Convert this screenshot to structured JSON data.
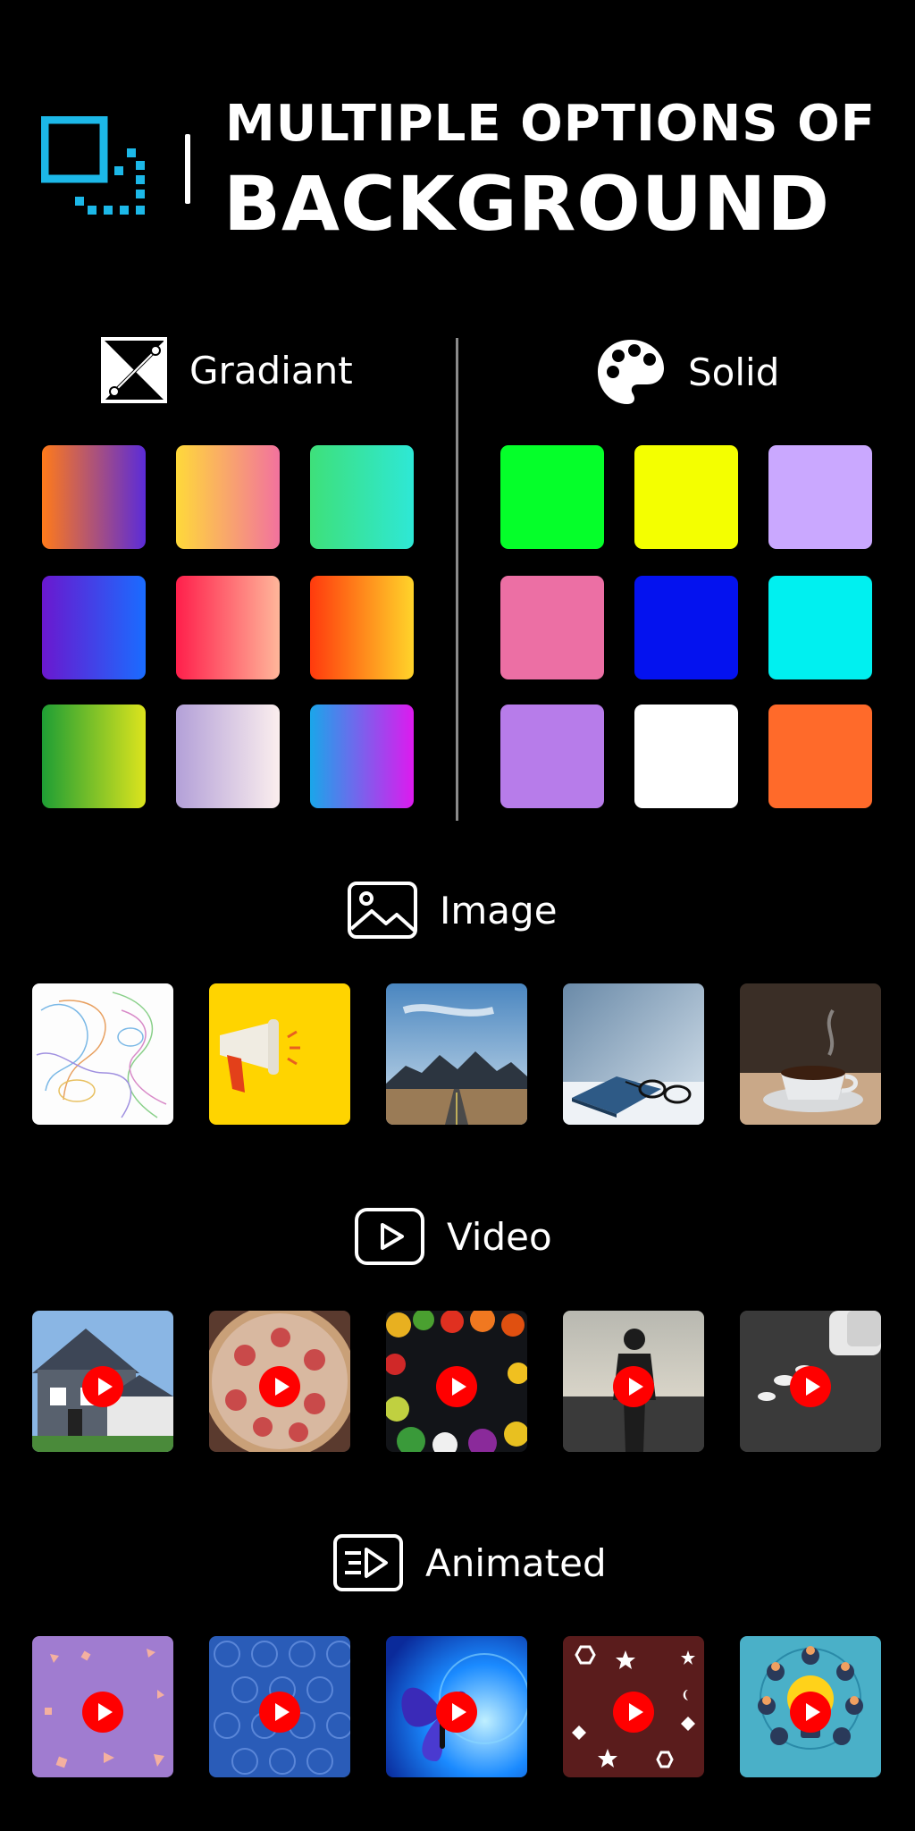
{
  "header": {
    "title_line1": "MULTIPLE OPTIONS OF",
    "title_line2": "BACKGROUND",
    "icon": "resize-frame-icon",
    "accent": "#1cb8e8"
  },
  "gradient": {
    "label": "Gradiant",
    "icon": "gradient-frame-icon",
    "swatches": [
      [
        "#ff7a1a",
        "#5b2bd8"
      ],
      [
        "#ffd93a",
        "#f2729e"
      ],
      [
        "#3ee07a",
        "#2ee8d6"
      ],
      [
        "#6a18cf",
        "#1a6cff"
      ],
      [
        "#ff1f4b",
        "#ffb69a"
      ],
      [
        "#ff3a0d",
        "#ffd42a"
      ],
      [
        "#1e9e34",
        "#dde41d"
      ],
      [
        "#b3a0d8",
        "#fbeeee"
      ],
      [
        "#1aa6ea",
        "#dd1aee"
      ]
    ]
  },
  "solid": {
    "label": "Solid",
    "icon": "palette-icon",
    "swatches": [
      "#05ff2a",
      "#f4ff00",
      "#caa8ff",
      "#ec6fa4",
      "#0412ef",
      "#00f0f0",
      "#b77cea",
      "#ffffff",
      "#ff6a2a"
    ]
  },
  "image": {
    "label": "Image",
    "icon": "image-icon",
    "tiles": [
      "topographic-map",
      "megaphone",
      "mountain-road",
      "notebook-glasses",
      "coffee-cup"
    ]
  },
  "video": {
    "label": "Video",
    "icon": "video-play-icon",
    "tiles": [
      "house",
      "pizza",
      "vegetables",
      "runner",
      "pills"
    ]
  },
  "animated": {
    "label": "Animated",
    "icon": "animated-play-icon",
    "tiles": [
      "purple-shapes",
      "blue-circles",
      "butterfly",
      "maroon-shapes",
      "lightbulb"
    ]
  }
}
